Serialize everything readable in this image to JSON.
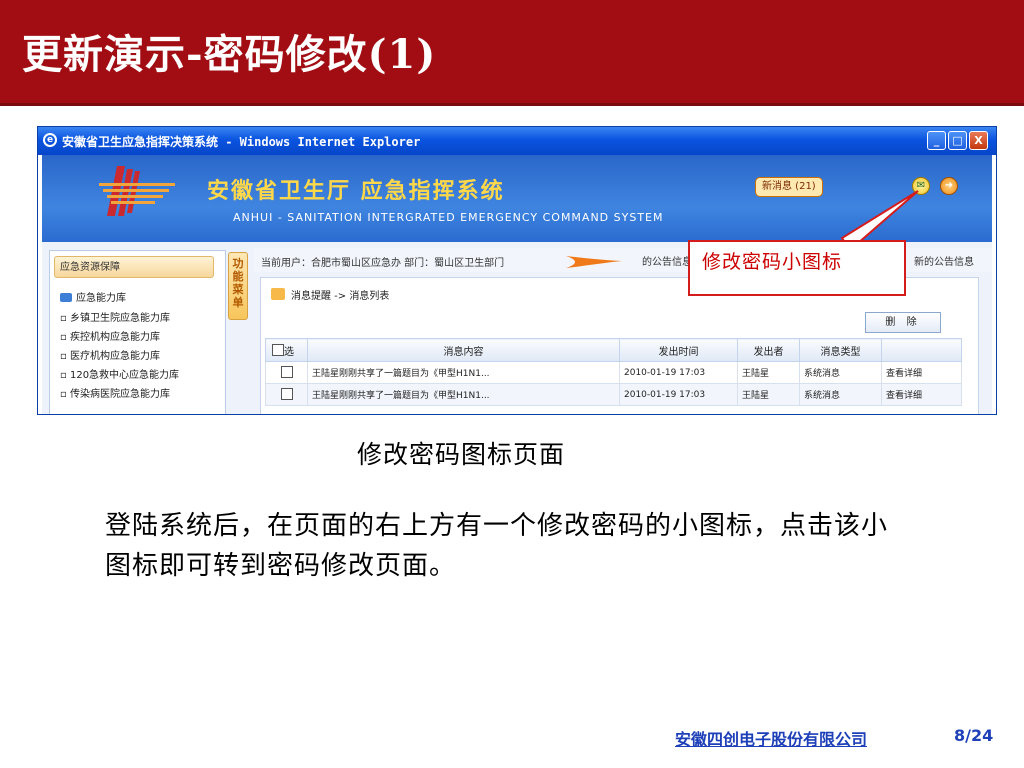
{
  "slide": {
    "title": "更新演示-密码修改(1)",
    "caption": "修改密码图标页面",
    "body": "登陆系统后，在页面的右上方有一个修改密码的小图标，点击该小图标即可转到密码修改页面。",
    "company": "安徽四创电子股份有限公司",
    "page": "8/24"
  },
  "browser": {
    "title": "安徽省卫生应急指挥决策系统 - Windows Internet Explorer",
    "min_label": "_",
    "max_label": "□",
    "close_label": "X"
  },
  "app": {
    "title_cn": "安徽省卫生厅   应急指挥系统",
    "title_en": "ANHUI - SANITATION INTERGRATED EMERGENCY COMMAND SYSTEM",
    "new_messages": "新消息 (21)",
    "current_user": "当前用户：合肥市蜀山区应急办   部门：蜀山区卫生部门",
    "notice_left": "的公告信息：",
    "notice_right": "新的公告信息"
  },
  "sidebar": {
    "header": "应急资源保障",
    "folder": "应急能力库",
    "items": [
      "乡镇卫生院应急能力库",
      "疾控机构应急能力库",
      "医疗机构应急能力库",
      "120急救中心应急能力库",
      "传染病医院应急能力库"
    ],
    "menu_tab": "功能菜单"
  },
  "content": {
    "breadcrumb": "消息提醒 -> 消息列表",
    "delete_label": "删 除",
    "columns": [
      "选",
      "消息内容",
      "发出时间",
      "发出者",
      "消息类型",
      ""
    ],
    "rows": [
      {
        "content": "王陆星刚刚共享了一篇题目为《甲型H1N1...",
        "time": "2010-01-19 17:03",
        "sender": "王陆星",
        "type": "系统消息",
        "action": "查看详细"
      },
      {
        "content": "王陆星刚刚共享了一篇题目为《甲型H1N1...",
        "time": "2010-01-19 17:03",
        "sender": "王陆星",
        "type": "系统消息",
        "action": "查看详细"
      }
    ]
  },
  "callout": {
    "text": "修改密码小图标"
  },
  "colors": {
    "header_red": "#a10d12",
    "callout_red": "#d51c1c",
    "footer_blue": "#1d3fb8"
  }
}
